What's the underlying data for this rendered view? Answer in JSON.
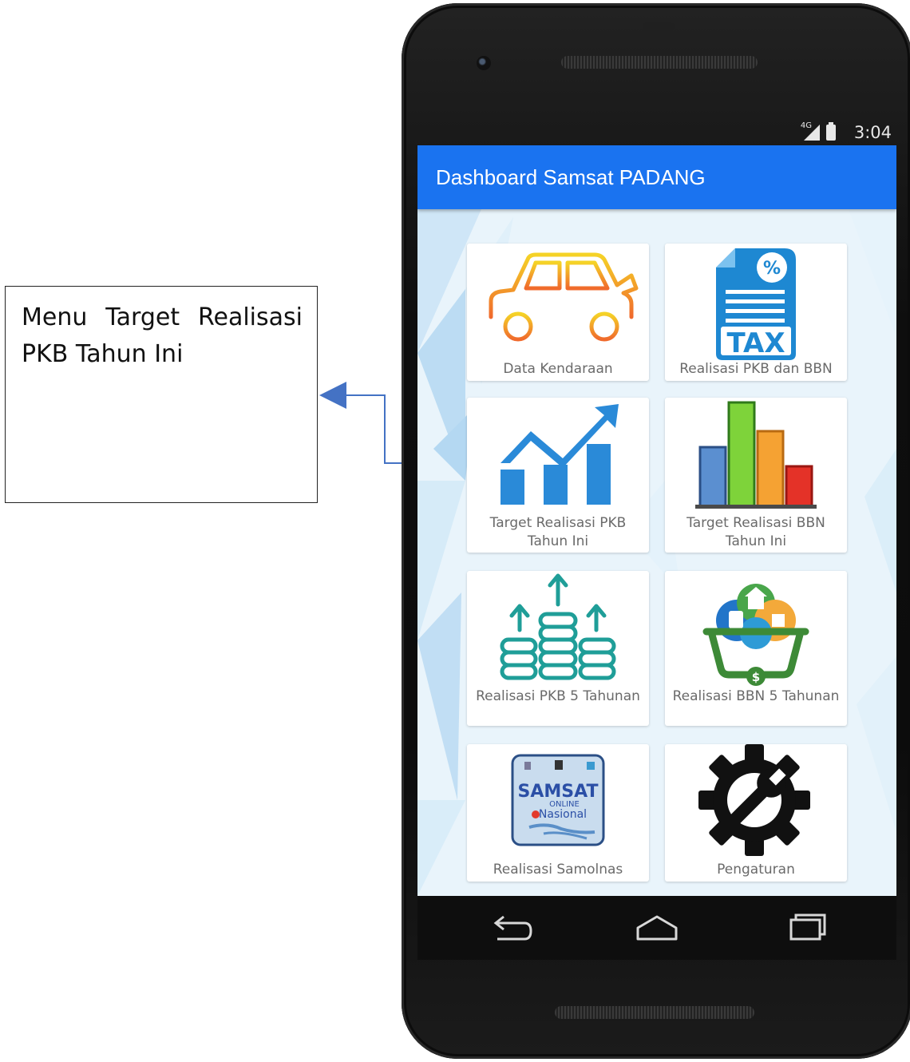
{
  "callout": {
    "text": "Menu Target Realisasi PKB Tahun Ini"
  },
  "status_bar": {
    "network": "4G",
    "time": "3:04"
  },
  "app": {
    "title": "Dashboard Samsat PADANG"
  },
  "menu": [
    {
      "label": "Data Kendaraan",
      "icon": "car-icon"
    },
    {
      "label": "Realisasi PKB dan BBN",
      "icon": "tax-document-icon"
    },
    {
      "label": "Target Realisasi PKB Tahun Ini",
      "icon": "growth-chart-icon"
    },
    {
      "label": "Target Realisasi BBN Tahun Ini",
      "icon": "bar-chart-icon"
    },
    {
      "label": "Realisasi PKB 5 Tahunan",
      "icon": "coin-stacks-up-icon"
    },
    {
      "label": "Realisasi BBN 5 Tahunan",
      "icon": "basket-icon"
    },
    {
      "label": "Realisasi Samolnas",
      "icon": "samsat-logo-icon"
    },
    {
      "label": "Pengaturan",
      "icon": "gear-wrench-icon"
    }
  ],
  "samsat_logo": {
    "line1": "SAMSAT",
    "line2": "ONLINE",
    "line3": "Nasional"
  },
  "colors": {
    "appbar": "#1a73f0",
    "chart_blue": "#2a8ad8",
    "coins_teal": "#1f9e98"
  },
  "nav": {
    "back": "back-icon",
    "home": "home-icon",
    "recents": "recents-icon"
  }
}
